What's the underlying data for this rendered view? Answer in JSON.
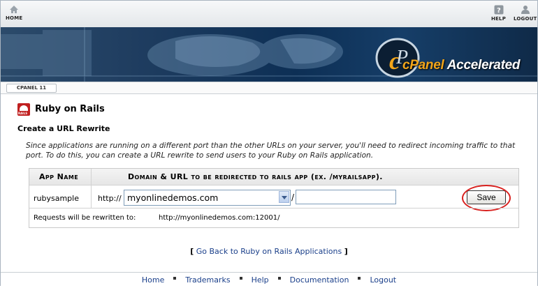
{
  "topbar": {
    "home_label": "HOME",
    "help_label": "HELP",
    "logout_label": "LOGOUT",
    "home_icon": "home-icon",
    "help_icon": "question-mark-icon",
    "logout_icon": "user-logout-icon"
  },
  "banner": {
    "brand_prefix": "cPanel",
    "brand_suffix": "Accelerated",
    "brand_color": "#f2a51a"
  },
  "version_tab": "CPANEL 11",
  "page": {
    "title": "Ruby on Rails",
    "section_title": "Create a URL Rewrite",
    "icon_label": "RAILS",
    "description": "Since applications are running on a different port than the other URLs on your server, you'll need to redirect incoming traffic to that port. To do this, you can create a URL rewrite to send users to your Ruby on Rails application."
  },
  "form": {
    "col_app_name": "App Name",
    "col_domain": "Domain & URL to be redirected to rails app (ex. /myrailsapp).",
    "app_name": "rubysample",
    "protocol_prefix": "http://",
    "domain_selected": "myonlinedemos.com",
    "path_separator": "/",
    "path_value": "",
    "save_label": "Save",
    "rewrite_label": "Requests will be rewritten to:",
    "rewrite_url": "http://myonlinedemos.com:12001/"
  },
  "back_link": {
    "open": "[",
    "label": "Go Back to Ruby on Rails Applications",
    "close": "]"
  },
  "footer": {
    "home": "Home",
    "trademarks": "Trademarks",
    "help": "Help",
    "documentation": "Documentation",
    "logout": "Logout"
  },
  "colors": {
    "link": "#1a3f8a",
    "highlight_circle": "#d8201e",
    "rails_red": "#c01f1f"
  }
}
